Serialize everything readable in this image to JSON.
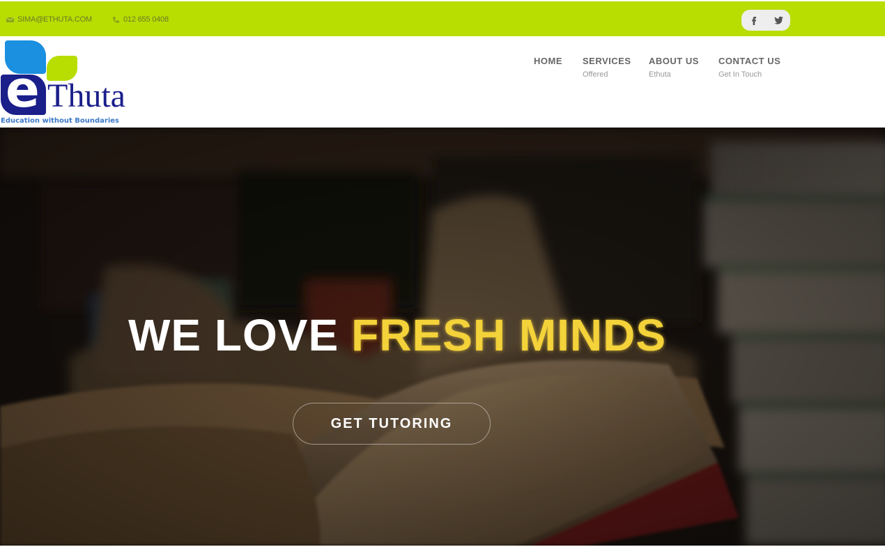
{
  "topbar": {
    "email": "SIMA@ETHUTA.COM",
    "phone": "012 655 0408",
    "background": "#b8dd00",
    "email_icon": "envelope-icon",
    "phone_icon": "phone-icon",
    "social": [
      {
        "name": "facebook-icon",
        "glyph": "f"
      },
      {
        "name": "twitter-icon"
      }
    ]
  },
  "logo": {
    "letter": "e",
    "wordmark": "Thuta",
    "tagline": "Education without Boundaries",
    "colors": {
      "blue": "#1b8fe0",
      "green": "#b8dd00",
      "navy": "#1b1f8a"
    }
  },
  "nav": {
    "items": [
      {
        "label": "HOME",
        "sub": ""
      },
      {
        "label": "SERVICES",
        "sub": "Offered"
      },
      {
        "label": "ABOUT US",
        "sub": "Ethuta"
      },
      {
        "label": "CONTACT US",
        "sub": "Get In Touch"
      }
    ]
  },
  "hero": {
    "headline_white": "WE LOVE",
    "headline_yellow": "FRESH MINDS",
    "cta_label": "GET TUTORING",
    "accent": "#f4d23a"
  }
}
